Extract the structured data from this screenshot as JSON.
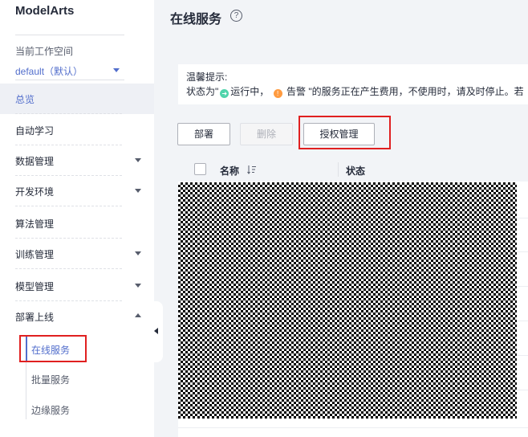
{
  "sidebar": {
    "brand": "ModelArts",
    "workspace_label": "当前工作空间",
    "workspace_value": "default（默认）",
    "items": [
      {
        "label": "总览"
      },
      {
        "label": "自动学习"
      },
      {
        "label": "数据管理"
      },
      {
        "label": "开发环境"
      },
      {
        "label": "算法管理"
      },
      {
        "label": "训练管理"
      },
      {
        "label": "模型管理"
      },
      {
        "label": "部署上线"
      }
    ],
    "subitems": [
      {
        "label": "在线服务"
      },
      {
        "label": "批量服务"
      },
      {
        "label": "边缘服务"
      }
    ]
  },
  "main": {
    "title": "在线服务",
    "help_glyph": "?",
    "tip": {
      "title": "温馨提示:",
      "line_part1": "状态为\"",
      "running": "运行中",
      "comma": "，",
      "alarm": "告警",
      "line_part2": "\"的服务正在产生费用，不使用时，请及时停止。若"
    },
    "toolbar": {
      "deploy": "部署",
      "delete": "删除",
      "auth": "授权管理"
    },
    "table": {
      "col_name": "名称",
      "col_status": "状态"
    }
  },
  "colors": {
    "accent": "#526ecc",
    "highlight": "#e02020",
    "running": "#50d4ab",
    "alarm": "#ff9b40"
  },
  "icons": [
    "help-icon",
    "sort-icon",
    "caret-down-icon",
    "caret-up-icon",
    "collapse-arrow-icon",
    "running-status-icon",
    "alarm-status-icon"
  ]
}
